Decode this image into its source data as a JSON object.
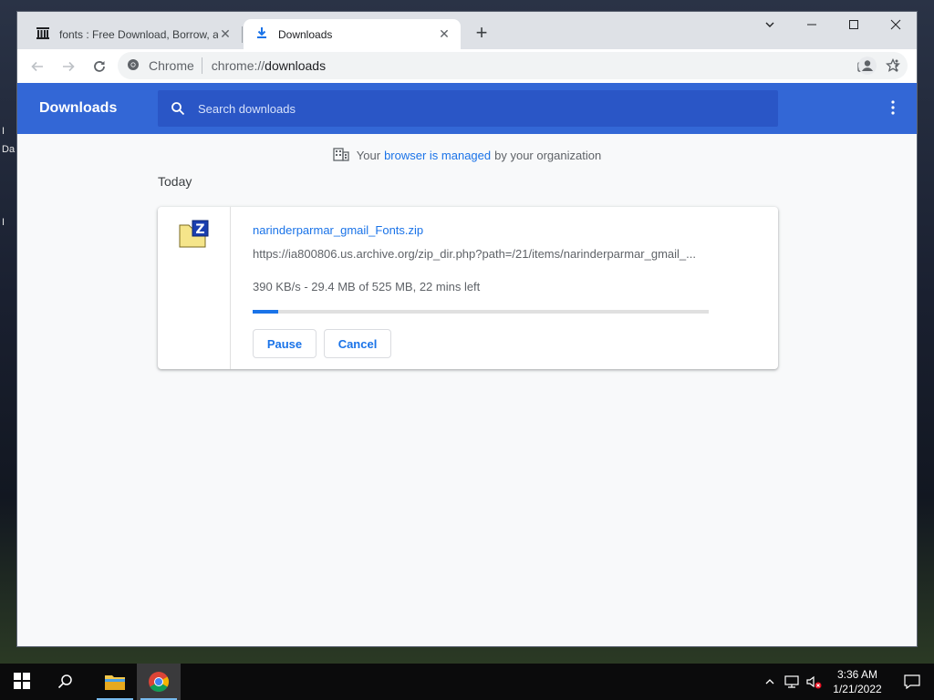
{
  "desktop": {
    "glyphs": [
      "I",
      "Da",
      "I"
    ]
  },
  "browser": {
    "tabs": [
      {
        "title": "fonts : Free Download, Borrow, and Streaming : Internet Archive",
        "icon": "archive-icon",
        "active": false
      },
      {
        "title": "Downloads",
        "icon": "download-icon",
        "active": true
      }
    ],
    "omnibox": {
      "site_label": "Chrome",
      "url_scheme": "chrome://",
      "url_host": "downloads"
    }
  },
  "downloads": {
    "header_title": "Downloads",
    "search_placeholder": "Search downloads",
    "managed": {
      "prefix": "Your",
      "link": "browser is managed",
      "suffix": "by your organization"
    },
    "date_heading": "Today",
    "items": [
      {
        "file_name": "narinderparmar_gmail_Fonts.zip",
        "url": "https://ia800806.us.archive.org/zip_dir.php?path=/21/items/narinderparmar_gmail_...",
        "status": "390 KB/s - 29.4 MB of 525 MB, 22 mins left",
        "progress": 0.056,
        "pause_label": "Pause",
        "cancel_label": "Cancel"
      }
    ]
  },
  "taskbar": {
    "time": "3:36 AM",
    "date": "1/21/2022"
  },
  "colors": {
    "accent": "#3367d6",
    "search_bg": "#2a56c6",
    "link": "#1a73e8"
  }
}
